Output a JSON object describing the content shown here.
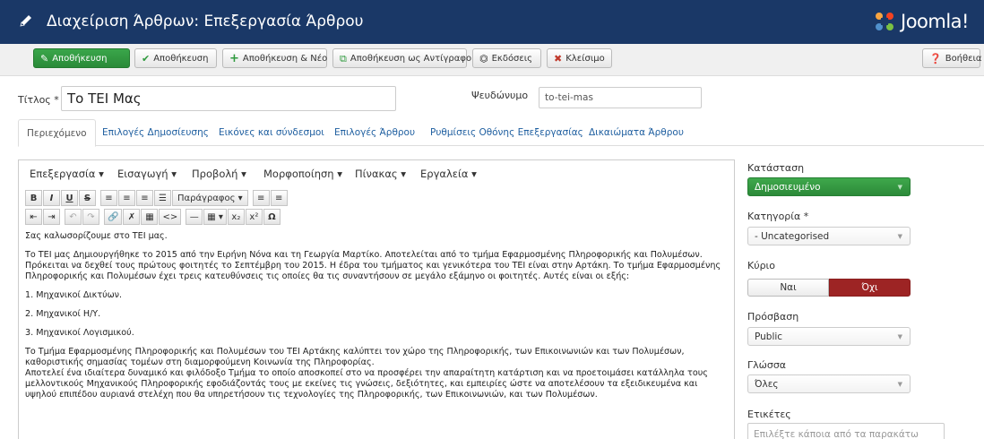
{
  "header": {
    "title": "Διαχείριση Άρθρων: Επεξεργασία Άρθρου",
    "logo_text": "Joomla!"
  },
  "toolbar": {
    "save": "Αποθήκευση",
    "save_close": "Αποθήκευση",
    "save_new": "Αποθήκευση & Νέο",
    "save_copy": "Αποθήκευση ως Αντίγραφο",
    "versions": "Εκδόσεις",
    "close": "Κλείσιμο",
    "help": "Βοήθεια"
  },
  "form": {
    "title_label": "Τίτλος *",
    "title_value": "Το ΤΕΙ Μας",
    "alias_label": "Ψευδώνυμο",
    "alias_value": "to-tei-mas"
  },
  "tabs": [
    "Περιεχόμενο",
    "Επιλογές Δημοσίευσης",
    "Εικόνες και σύνδεσμοι",
    "Επιλογές Άρθρου",
    "Ρυθμίσεις Οθόνης Επεξεργασίας",
    "Δικαιώματα Άρθρου"
  ],
  "editor": {
    "menus": [
      "Επεξεργασία",
      "Εισαγωγή",
      "Προβολή",
      "Μορφοποίηση",
      "Πίνακας",
      "Εργαλεία"
    ],
    "format_select": "Παράγραφος",
    "paragraphs": [
      "Σας καλωσορίζουμε στο ΤΕΙ μας.",
      "Το ΤΕΙ μας Δημιουργήθηκε το 2015 από την Ειρήνη Νόνα και τη Γεωργία Μαρτίκο. Αποτελείται από το τμήμα Εφαρμοσμένης Πληροφορικής και Πολυμέσων. Πρόκειται να δεχθεί τους πρώτους φοιτητές το Σεπτέμβρη του 2015. Η έδρα του τμήματος και γενικότερα του ΤΕΙ είναι στην Αρτάκη. Το τμήμα Εφαρμοσμένης Πληροφορικής και Πολυμέσων έχει τρεις κατευθύνσεις τις οποίες θα τις συναντήσουν σε μεγάλο εξάμηνο οι φοιτητές. Αυτές είναι οι εξής:",
      "1. Μηχανικοί Δικτύων.",
      "2. Μηχανικοί Η/Υ.",
      "3. Μηχανικοί Λογισμικού.",
      "Το Τμήμα Εφαρμοσμένης Πληροφορικής και Πολυμέσων του ΤΕΙ Αρτάκης καλύπτει τον χώρο της Πληροφορικής, των Επικοινωνιών και των Πολυμέσων, καθοριστικής σημασίας τομέων στη διαμορφούμενη Κοινωνία της Πληροφορίας.\nΑποτελεί ένα ιδιαίτερα δυναμικό και φιλόδοξο Τμήμα το οποίο αποσκοπεί στο να προσφέρει την απαραίτητη κατάρτιση και να προετοιμάσει κατάλληλα τους μελλοντικούς Μηχανικούς Πληροφορικής εφοδιάζοντάς τους με εκείνες τις γνώσεις, δεξιότητες, και εμπειρίες ώστε να αποτελέσουν τα εξειδικευμένα και υψηλού επιπέδου αυριανά στελέχη που θα υπηρετήσουν τις τεχνολογίες της Πληροφορικής, των Επικοινωνιών, και των Πολυμέσων."
    ]
  },
  "side": {
    "status_label": "Κατάσταση",
    "status_value": "Δημοσιευμένο",
    "category_label": "Κατηγορία *",
    "category_value": "- Uncategorised",
    "featured_label": "Κύριο",
    "featured_yes": "Ναι",
    "featured_no": "Όχι",
    "access_label": "Πρόσβαση",
    "access_value": "Public",
    "language_label": "Γλώσσα",
    "language_value": "Όλες",
    "tags_label": "Ετικέτες",
    "tags_placeholder": "Επιλέξτε κάποια από τα παρακάτω"
  },
  "colors": {
    "header_bg": "#1a3867",
    "save_green": "#2f9a3e",
    "featured_no_red": "#9d2424",
    "link_blue": "#1f5fa0"
  }
}
